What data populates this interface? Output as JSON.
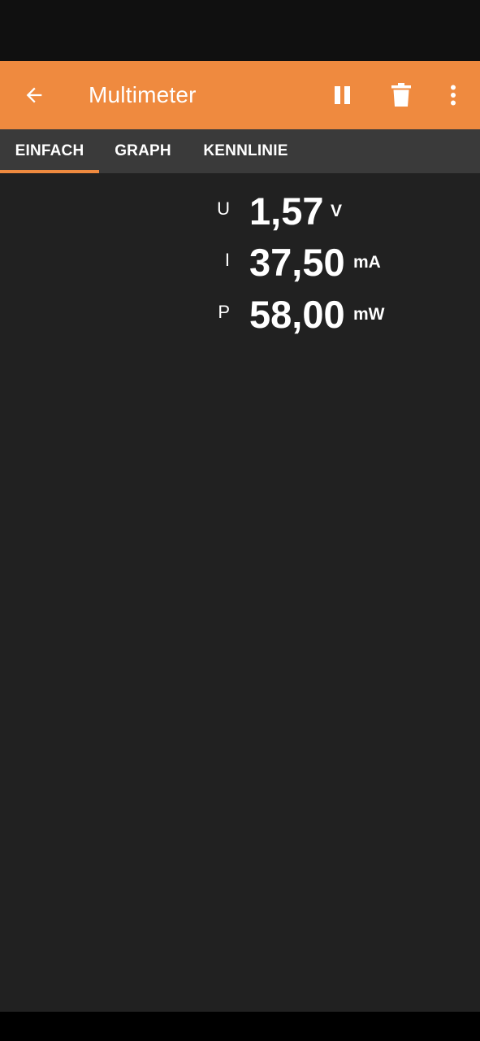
{
  "app_bar": {
    "title": "Multimeter",
    "icons": {
      "back": "arrow-back-icon",
      "pause": "pause-icon",
      "delete": "trash-icon",
      "more": "more-vert-icon"
    }
  },
  "tabs": [
    {
      "label": "EINFACH",
      "selected": true
    },
    {
      "label": "GRAPH",
      "selected": false
    },
    {
      "label": "KENNLINIE",
      "selected": false
    }
  ],
  "readings": [
    {
      "symbol": "U",
      "value": "1,57",
      "unit": "V"
    },
    {
      "symbol": "I",
      "value": "37,50",
      "unit": "mA"
    },
    {
      "symbol": "P",
      "value": "58,00",
      "unit": "mW"
    }
  ],
  "colors": {
    "accent": "#ef8a3f",
    "tab_bar": "#3a3a3a",
    "background": "#212121"
  }
}
